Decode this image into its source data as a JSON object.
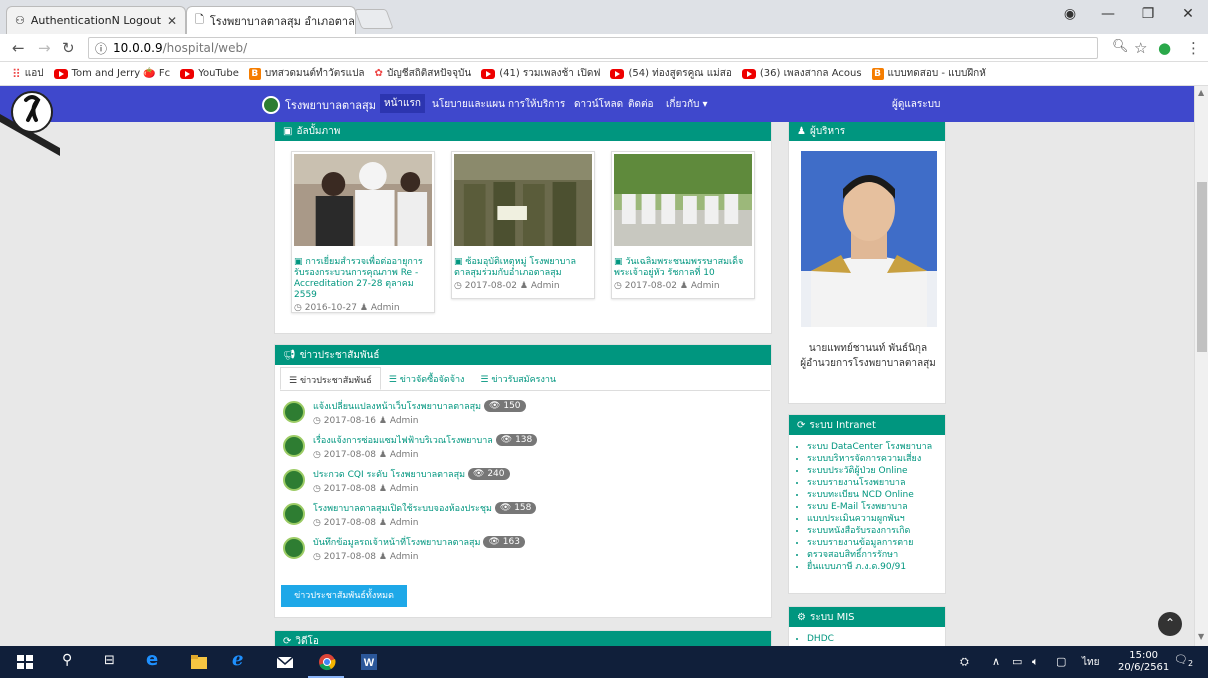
{
  "browser": {
    "tabs": [
      {
        "title": "AuthenticationN Logout"
      },
      {
        "title": "โรงพยาบาลตาลสุม อำเภอตาล"
      }
    ],
    "url_host": "10.0.0.9",
    "url_path": "/hospital/web/",
    "bookmarks": [
      {
        "label": "แอป",
        "icon": "apps-icon"
      },
      {
        "label": "Tom and Jerry 🍅 Fc",
        "icon": "youtube-icon"
      },
      {
        "label": "YouTube",
        "icon": "youtube-icon"
      },
      {
        "label": "บทสวดมนต์ทำวัตรแปล",
        "icon": "blogger-icon"
      },
      {
        "label": "บัญชีสถิติสหปัจจุบัน",
        "icon": "site-icon"
      },
      {
        "label": "(41) รวมเพลงช้า เปิดฟ",
        "icon": "youtube-icon"
      },
      {
        "label": "(54) ท่องสูตรคูณ แม่สอ",
        "icon": "youtube-icon"
      },
      {
        "label": "(36) เพลงสากล Acous",
        "icon": "youtube-icon"
      },
      {
        "label": "แบบทดสอบ - แบบฝึกหั",
        "icon": "blogger-icon"
      }
    ]
  },
  "site": {
    "brand": "โรงพยาบาลตาลสุม",
    "nav": [
      {
        "label": "หน้าแรก",
        "active": true
      },
      {
        "label": "นโยบายและแผน"
      },
      {
        "label": "การให้บริการ"
      },
      {
        "label": "ดาวน์โหลด"
      },
      {
        "label": "ติดต่อ"
      },
      {
        "label": "เกี่ยวกับ ▾"
      }
    ],
    "admin_link": "ผู้ดูแลระบบ"
  },
  "gallery": {
    "title": "อัลบั้มภาพ",
    "cards": [
      {
        "caption": "การเยี่ยมสำรวจเพื่อต่ออายุการรับรองกระบวนการคุณภาพ Re - Accreditation 27-28 ตุลาคม 2559",
        "date": "2016-10-27",
        "author": "Admin"
      },
      {
        "caption": "ซ้อมอุบัติเหตุหมู่ โรงพยาบาลตาลสุมร่วมกับอำเภอตาลสุม",
        "date": "2017-08-02",
        "author": "Admin"
      },
      {
        "caption": "วันเฉลิมพระชนมพรรษาสมเด็จพระเจ้าอยู่หัว รัชกาลที่ 10",
        "date": "2017-08-02",
        "author": "Admin"
      }
    ]
  },
  "news": {
    "title": "ข่าวประชาสัมพันธ์",
    "tabs": [
      "ข่าวประชาสัมพันธ์",
      "ข่าวจัดซื้อจัดจ้าง",
      "ข่าวรับสมัครงาน"
    ],
    "items": [
      {
        "title": "แจ้งเปลี่ยนแปลงหน้าเว็บโรงพยาบาลตาลสุม",
        "views": "150",
        "date": "2017-08-16",
        "author": "Admin"
      },
      {
        "title": "เรื่องแจ้งการซ่อมแซมไฟฟ้าบริเวณโรงพยาบาล",
        "views": "138",
        "date": "2017-08-08",
        "author": "Admin"
      },
      {
        "title": "ประกวด CQI ระดับ โรงพยาบาลตาลสุม",
        "views": "240",
        "date": "2017-08-08",
        "author": "Admin"
      },
      {
        "title": "โรงพยาบาลตาลสุมเปิดใช้ระบบจองห้องประชุม",
        "views": "158",
        "date": "2017-08-08",
        "author": "Admin"
      },
      {
        "title": "บันทึกข้อมูลรถเจ้าหน้าที่โรงพยาบาลตาลสุม",
        "views": "163",
        "date": "2017-08-08",
        "author": "Admin"
      }
    ],
    "all_button": "ข่าวประชาสัมพันธ์ทั้งหมด"
  },
  "video": {
    "title": "วิดีโอ"
  },
  "director": {
    "title": "ผู้บริหาร",
    "name": "นายแพทย์ชานนท์ พันธ์นิกุล",
    "position": "ผู้อำนวยการโรงพยาบาลตาลสุม"
  },
  "intranet": {
    "title": "ระบบ Intranet",
    "items": [
      "ระบบ DataCenter โรงพยาบาล",
      "ระบบบริหารจัดการความเสี่ยง",
      "ระบบประวัติผู้ป่วย Online",
      "ระบบรายงานโรงพยาบาล",
      "ระบบทะเบียน NCD Online",
      "ระบบ E-Mail โรงพยาบาล",
      "แบบประเมินความผูกพันฯ",
      "ระบบหนังสือรับรองการเกิด",
      "ระบบรายงานข้อมูลการตาย",
      "ตรวจสอบสิทธิ์การรักษา",
      "ยื่นแบบภาษี ภ.ง.ด.90/91"
    ]
  },
  "mis": {
    "title": "ระบบ MIS",
    "items": [
      "DHDC"
    ]
  },
  "taskbar": {
    "lang": "ไทย",
    "time": "15:00",
    "date": "20/6/2561",
    "notifications": "2"
  },
  "colors": {
    "nav": "#3f48cc",
    "panel": "#00967f",
    "taskbar": "#101f3a"
  }
}
